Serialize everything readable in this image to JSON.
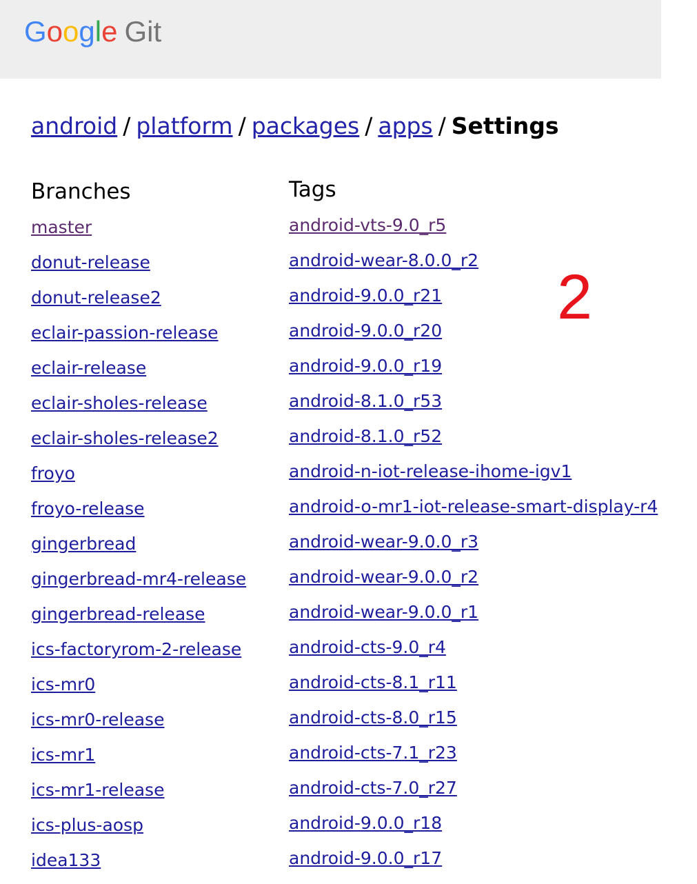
{
  "header": {
    "logo_letters": [
      "G",
      "o",
      "o",
      "g",
      "l",
      "e"
    ],
    "logo_suffix": "Git"
  },
  "breadcrumbs": {
    "items": [
      "android",
      "platform",
      "packages",
      "apps"
    ],
    "separator": "/",
    "current": "Settings"
  },
  "branches": {
    "heading": "Branches",
    "items": [
      "master",
      "donut-release",
      "donut-release2",
      "eclair-passion-release",
      "eclair-release",
      "eclair-sholes-release",
      "eclair-sholes-release2",
      "froyo",
      "froyo-release",
      "gingerbread",
      "gingerbread-mr4-release",
      "gingerbread-release",
      "ics-factoryrom-2-release",
      "ics-mr0",
      "ics-mr0-release",
      "ics-mr1",
      "ics-mr1-release",
      "ics-plus-aosp",
      "idea133"
    ]
  },
  "tags": {
    "heading": "Tags",
    "items": [
      "android-vts-9.0_r5",
      "android-wear-8.0.0_r2",
      "android-9.0.0_r21",
      "android-9.0.0_r20",
      "android-9.0.0_r19",
      "android-8.1.0_r53",
      "android-8.1.0_r52",
      "android-n-iot-release-ihome-igv1",
      "android-o-mr1-iot-release-smart-display-r4",
      "android-wear-9.0.0_r3",
      "android-wear-9.0.0_r2",
      "android-wear-9.0.0_r1",
      "android-cts-9.0_r4",
      "android-cts-8.1_r11",
      "android-cts-8.0_r15",
      "android-cts-7.1_r23",
      "android-cts-7.0_r27",
      "android-9.0.0_r18",
      "android-9.0.0_r17"
    ]
  },
  "annotation": {
    "label": "2"
  },
  "colors": {
    "header_bg": "#eeeeee",
    "link": "#1d1d9e",
    "visited_link": "#5c2a6e",
    "annotation": "#e8141c"
  }
}
